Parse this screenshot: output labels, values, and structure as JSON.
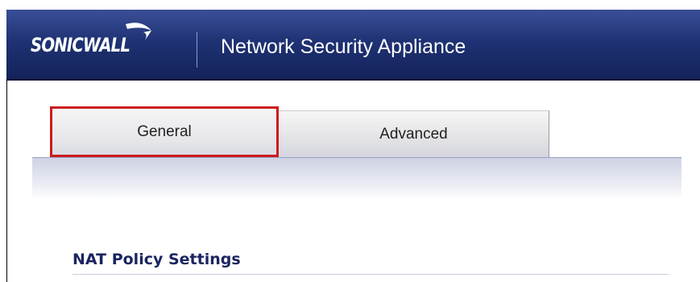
{
  "header": {
    "brand": "SONICWALL",
    "app_title": "Network Security Appliance"
  },
  "tabs": [
    {
      "label": "General",
      "selected": true
    },
    {
      "label": "Advanced",
      "selected": false
    }
  ],
  "section": {
    "title": "NAT Policy Settings"
  },
  "colors": {
    "header_dark": "#14225a",
    "header_light": "#3a4f96",
    "highlight_red": "#cc1b1b",
    "section_title": "#1a2560"
  },
  "icons": {
    "logo_swoosh": "sonicwall-swoosh-icon"
  }
}
